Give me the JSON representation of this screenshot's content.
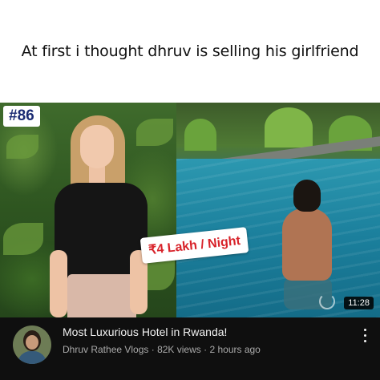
{
  "caption": {
    "text": "At first i thought dhruv is selling his girlfriend"
  },
  "thumbnail": {
    "badge": "#86",
    "price_tag": "₹4 Lakh / Night",
    "duration": "11:28"
  },
  "video": {
    "title": "Most Luxurious Hotel in Rwanda!",
    "channel": "Dhruv Rathee Vlogs",
    "separator": "·",
    "views": "82K views",
    "age": "2 hours ago"
  },
  "icons": {
    "avatar": "channel-avatar",
    "more": "more-vert-icon",
    "loading": "loading-icon"
  },
  "colors": {
    "badge_text": "#1a2a73",
    "price_text": "#d8232a",
    "meta_background": "#0f0f0f"
  }
}
